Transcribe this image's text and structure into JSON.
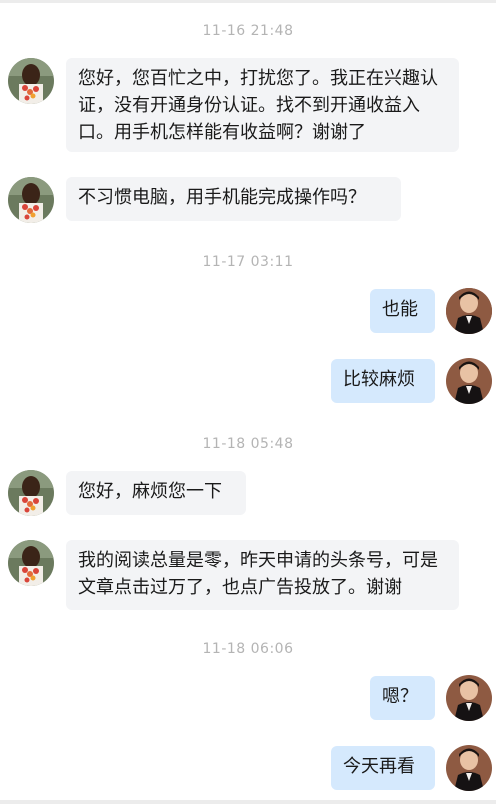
{
  "timestamps": [
    "11-16 21:48",
    "11-17 03:11",
    "11-18 05:48",
    "11-18 06:06"
  ],
  "messages": [
    {
      "direction": "in",
      "text": "您好，您百忙之中，打扰您了。我正在兴趣认证，没有开通身份认证。找不到开通收益入口。用手机怎样能有收益啊？谢谢了"
    },
    {
      "direction": "in",
      "text": "不习惯电脑，用手机能完成操作吗？"
    },
    {
      "direction": "out",
      "text": "也能"
    },
    {
      "direction": "out",
      "text": "比较麻烦"
    },
    {
      "direction": "in",
      "text": "您好，麻烦您一下"
    },
    {
      "direction": "in",
      "text": "我的阅读总量是零，昨天申请的头条号，可是文章点击过万了，也点广告投放了。谢谢"
    },
    {
      "direction": "out",
      "text": "嗯？"
    },
    {
      "direction": "out",
      "text": "今天再看"
    }
  ],
  "colors": {
    "incoming_bubble": "#f3f4f6",
    "outgoing_bubble": "#d5e9fd",
    "timestamp_text": "#b4b4b4"
  },
  "avatars": {
    "incoming": "user-avatar-icon",
    "outgoing": "support-avatar-icon"
  }
}
